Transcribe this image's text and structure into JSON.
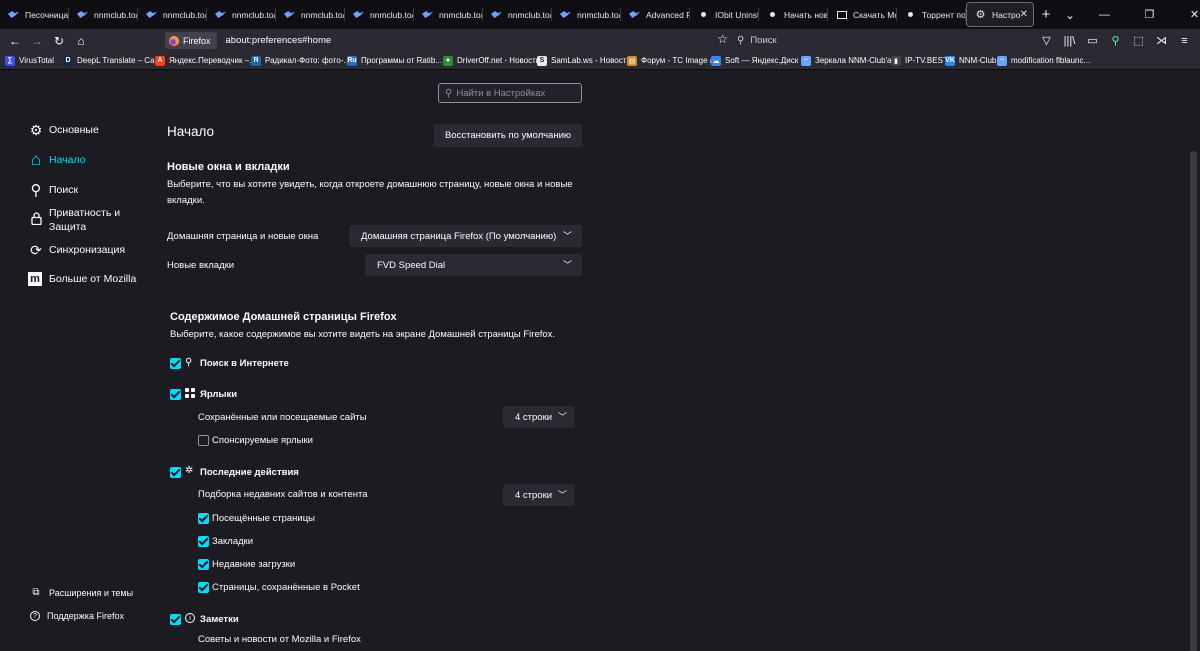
{
  "tabs": [
    {
      "label": "Песочница",
      "icon": "bird"
    },
    {
      "label": "nnmclub.to/",
      "icon": "bird"
    },
    {
      "label": "nnmclub.to/",
      "icon": "bird"
    },
    {
      "label": "nnmclub.to/",
      "icon": "bird"
    },
    {
      "label": "nnmclub.to/",
      "icon": "bird"
    },
    {
      "label": "nnmclub.to/",
      "icon": "bird"
    },
    {
      "label": "nnmclub.to/",
      "icon": "bird"
    },
    {
      "label": "nnmclub.to/",
      "icon": "bird"
    },
    {
      "label": "nnmclub.to/",
      "icon": "bird"
    },
    {
      "label": "Advanced R",
      "icon": "bird"
    },
    {
      "label": "IObit Uninst",
      "icon": "dot"
    },
    {
      "label": "Начать нову",
      "icon": "dot"
    },
    {
      "label": "Скачать Мо",
      "icon": "sq"
    },
    {
      "label": "Торрент пор",
      "icon": "dot"
    }
  ],
  "active_tab": {
    "label": "Настройк",
    "close": "✕"
  },
  "tabstrip": {
    "new_tab": "+",
    "list_tabs": "⌄"
  },
  "window": {
    "minimize": "—",
    "restore": "❐",
    "close": "✕"
  },
  "nav": {
    "back": "←",
    "forward": "→",
    "reload": "↻",
    "home": "⌂",
    "identity_label": "Firefox",
    "url": "about:preferences#home",
    "bookmark_star": "☆",
    "search_placeholder": "Поиск",
    "tools": [
      "▽",
      "|||\\",
      "▭",
      "⚲",
      "⬚",
      "⋊",
      "≡"
    ]
  },
  "bookmarks": [
    {
      "label": "VirusTotal",
      "icon_text": "∑",
      "color": "#394eff"
    },
    {
      "label": "DeepL Translate – Сам...",
      "icon_text": "D",
      "color": "#0f2b46"
    },
    {
      "label": "Яндекс.Переводчик –...",
      "icon_text": "A",
      "color": "#fc3f1d"
    },
    {
      "label": "Радикал-Фото: фото-...",
      "icon_text": "R",
      "color": "#2266aa"
    },
    {
      "label": "Программы от Ratib...",
      "icon_text": "Ru",
      "color": "#2a6cc4"
    },
    {
      "label": "DriverOff.net - Новости",
      "icon_text": "●",
      "color": "#2e8b3a"
    },
    {
      "label": "SamLab.ws - Новости",
      "icon_text": "S",
      "color": "#e8e8e8"
    },
    {
      "label": "Форум - TC Image an...",
      "icon_text": "▤",
      "color": "#d08a2c"
    },
    {
      "label": "Soft — Яндекс.Диск",
      "icon_text": "☁",
      "color": "#3b84e8"
    },
    {
      "label": "Зеркала NNM-Club'a ...",
      "icon_text": "~",
      "color": "#6ba4ff"
    },
    {
      "label": "IP-TV.BEST",
      "icon_text": "▮",
      "color": "#444"
    },
    {
      "label": "NNM-Club",
      "icon_text": "VK",
      "color": "#2787f5"
    },
    {
      "label": "modification flblaunc...",
      "icon_text": "~",
      "color": "#6ba4ff"
    }
  ],
  "find": {
    "placeholder": "Найти в Настройках"
  },
  "categories": [
    {
      "label": "Основные",
      "icon": "⚙"
    },
    {
      "label": "Начало",
      "icon": "⌂"
    },
    {
      "label": "Поиск",
      "icon": "⚲"
    },
    {
      "label": "Приватность и",
      "label2": "Защита",
      "icon": "🔒"
    },
    {
      "label": "Синхронизация",
      "icon": "⟳"
    },
    {
      "label": "Больше от Mozilla",
      "icon": "m"
    }
  ],
  "footer_links": [
    {
      "label": "Расширения и темы",
      "icon": "⧉"
    },
    {
      "label": "Поддержка Firefox",
      "icon": "?"
    }
  ],
  "page": {
    "title": "Начало",
    "restore_button": "Восстановить по умолчанию",
    "windows_section": {
      "title": "Новые окна и вкладки",
      "description_l1": "Выберите, что вы хотите увидеть, когда откроете домашнюю страницу, новые окна и новые",
      "description_l2": "вкладки.",
      "homepage_label": "Домашняя страница и новые окна",
      "homepage_value": "Домашняя страница Firefox (По умолчанию)",
      "newtabs_label": "Новые вкладки",
      "newtabs_value": "FVD Speed Dial"
    },
    "content_section": {
      "title": "Содержимое Домашней страницы Firefox",
      "description": "Выберите, какое содержимое вы хотите видеть на экране Домашней страницы Firefox.",
      "web_search": "Поиск в Интернете",
      "shortcuts": "Ярлыки",
      "shortcuts_sub": "Сохранённые или посещаемые сайты",
      "shortcuts_rows": "4 строки",
      "sponsored": "Спонсируемые ярлыки",
      "highlights": "Последние действия",
      "highlights_sub": "Подборка недавних сайтов и контента",
      "highlights_rows": "4 строки",
      "visited": "Посещённые страницы",
      "bookmarks": "Закладки",
      "downloads": "Недавние загрузки",
      "pocket": "Страницы, сохранённые в Pocket",
      "snippets": "Заметки",
      "snippets_sub": "Советы и новости от Mozilla и Firefox"
    }
  },
  "colors": {
    "accent": "#00ddff",
    "bg": "#1c1b22",
    "toolbar": "#2b2a33",
    "tabstrip": "#0f0e13"
  }
}
